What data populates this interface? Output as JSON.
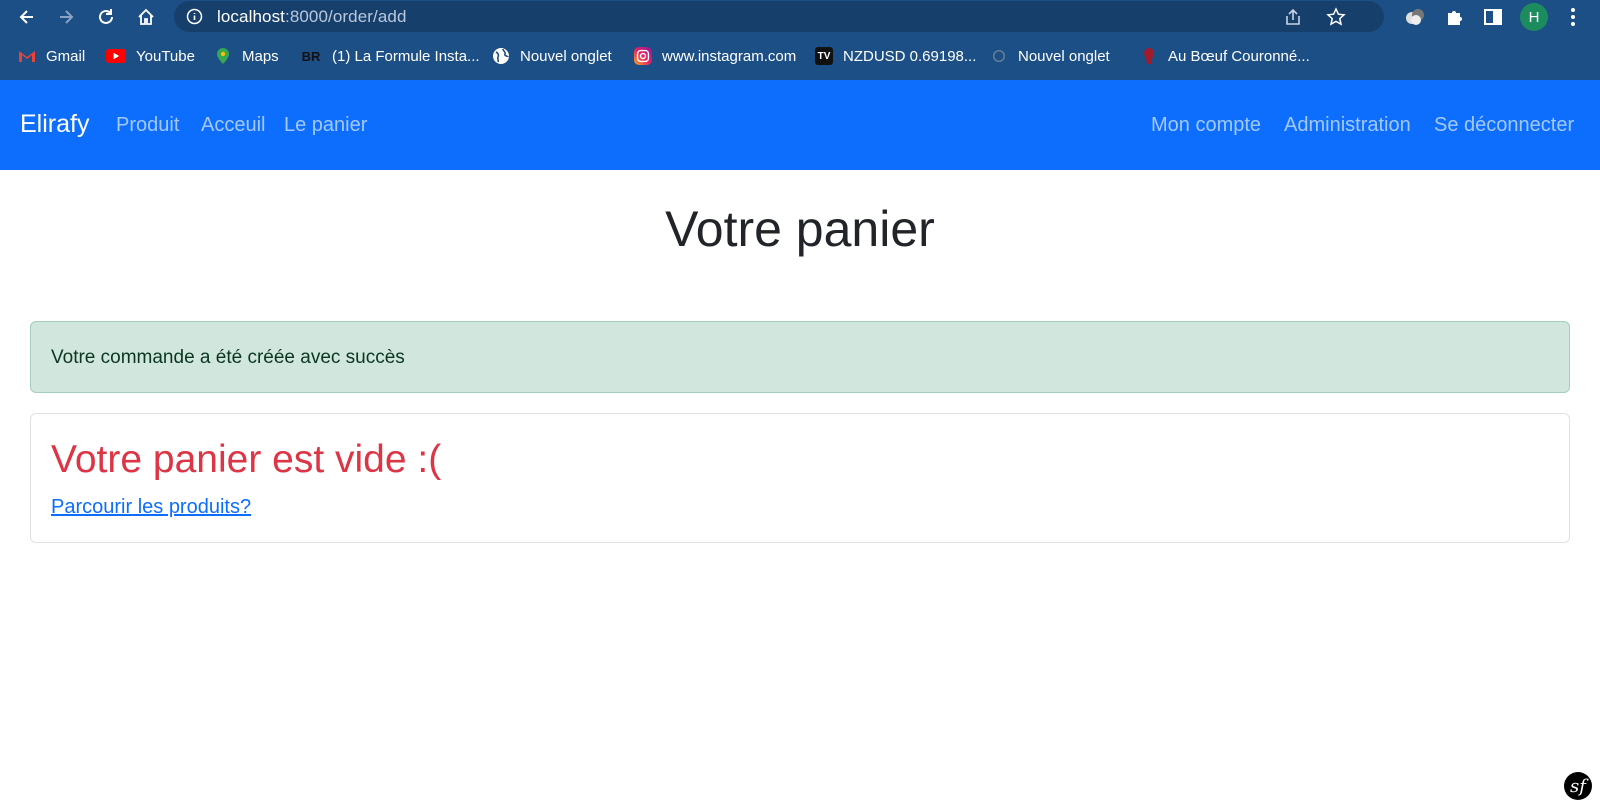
{
  "browser": {
    "url_host": "localhost",
    "url_rest": ":8000/order/add",
    "profile_initial": "H",
    "bookmarks": [
      {
        "label": "Gmail",
        "icon": "gmail-icon"
      },
      {
        "label": "YouTube",
        "icon": "youtube-icon"
      },
      {
        "label": "Maps",
        "icon": "maps-icon"
      },
      {
        "label": "(1) La Formule Insta...",
        "icon": "br-icon"
      },
      {
        "label": "Nouvel onglet",
        "icon": "globe-icon"
      },
      {
        "label": "www.instagram.com",
        "icon": "instagram-icon"
      },
      {
        "label": "NZDUSD 0.69198...",
        "icon": "tradingview-icon"
      },
      {
        "label": "Nouvel onglet",
        "icon": "tab-icon"
      },
      {
        "label": "Au Bœuf Couronné...",
        "icon": "restaurant-icon"
      }
    ]
  },
  "navbar": {
    "brand": "Elirafy",
    "left_links": [
      "Produit",
      "Acceuil",
      "Le panier"
    ],
    "right_links": [
      "Mon compte",
      "Administration",
      "Se déconnecter"
    ],
    "bg_color": "#0d6efd"
  },
  "main": {
    "title": "Votre panier",
    "alert": "Votre commande a été créée avec succès",
    "empty_title": "Votre panier est vide :(",
    "browse_link": "Parcourir les produits?"
  },
  "colors": {
    "chrome": "#1c4f86",
    "alert_bg": "#d1e7dd",
    "danger": "#dc3545",
    "link": "#0d6efd"
  }
}
